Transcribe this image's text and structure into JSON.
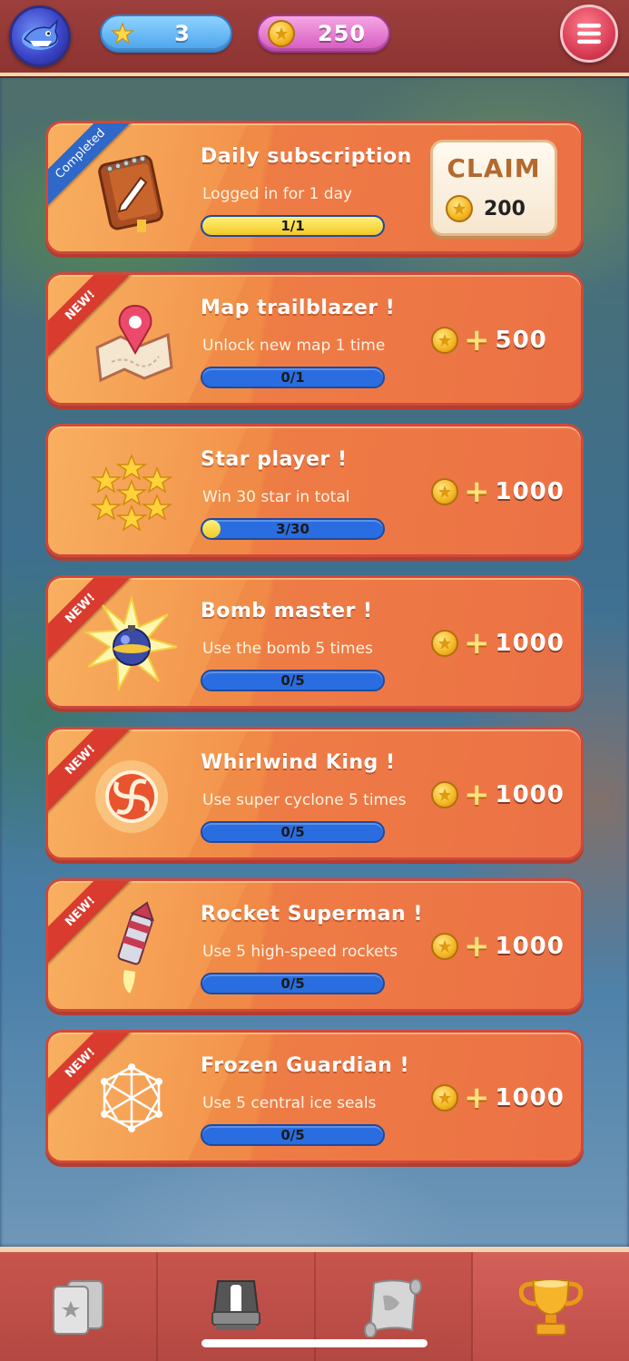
{
  "header": {
    "stars_count": "3",
    "coins_count": "250"
  },
  "tasks": [
    {
      "ribbon": "Completed",
      "title": "Daily subscription",
      "desc": "Logged in for 1 day",
      "progress_text": "1/1",
      "progress": 1.0,
      "claim_label": "CLAIM",
      "reward": "200",
      "icon": "notebook-icon"
    },
    {
      "ribbon": "NEW!",
      "title": "Map trailblazer !",
      "desc": "Unlock new map 1 time",
      "progress_text": "0/1",
      "progress": 0,
      "reward": "500",
      "icon": "map-pin-icon"
    },
    {
      "ribbon": "",
      "title": "Star player !",
      "desc": "Win 30 star in total",
      "progress_text": "3/30",
      "progress": 0.1,
      "reward": "1000",
      "icon": "stars-icon"
    },
    {
      "ribbon": "NEW!",
      "title": "Bomb master !",
      "desc": "Use the bomb 5 times",
      "progress_text": "0/5",
      "progress": 0,
      "reward": "1000",
      "icon": "bomb-icon"
    },
    {
      "ribbon": "NEW!",
      "title": "Whirlwind King !",
      "desc": "Use super cyclone 5 times",
      "progress_text": "0/5",
      "progress": 0,
      "reward": "1000",
      "icon": "cyclone-icon"
    },
    {
      "ribbon": "NEW!",
      "title": "Rocket Superman !",
      "desc": "Use 5 high-speed rockets",
      "progress_text": "0/5",
      "progress": 0,
      "reward": "1000",
      "icon": "rocket-icon"
    },
    {
      "ribbon": "NEW!",
      "title": "Frozen Guardian !",
      "desc": "Use 5 central ice seals",
      "progress_text": "0/5",
      "progress": 0,
      "reward": "1000",
      "icon": "ice-seal-icon"
    }
  ],
  "plus_sign": "+",
  "nav": {
    "items": [
      "cards-icon",
      "anvil-icon",
      "map-scroll-icon",
      "trophy-icon"
    ],
    "active": "trophy-icon"
  },
  "colors": {
    "card_orange": "#f08a46",
    "progress_blue": "#2a6de0",
    "progress_yellow": "#f3c826",
    "ribbon_new": "#d93c2f",
    "ribbon_completed": "#2e68c9",
    "topbar": "#9c3f3c"
  }
}
